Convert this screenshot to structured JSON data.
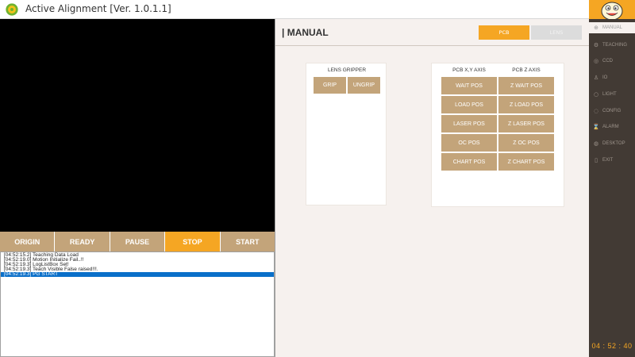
{
  "window": {
    "title": "Active Alignment [Ver. 1.0.1.1]"
  },
  "controls": [
    {
      "label": "ORIGIN",
      "active": false
    },
    {
      "label": "READY",
      "active": false
    },
    {
      "label": "PAUSE",
      "active": false
    },
    {
      "label": "STOP",
      "active": true
    },
    {
      "label": "START",
      "active": false
    }
  ],
  "log": [
    "[04:52:15.2]  Teaching Data Load",
    "[04:52:19.0]  Motion Initialize Fail..!!",
    "[04:52:19.3]  LogListBox Set!",
    "[04:52:19.3]  Teach Visible False raised!!!.",
    "[04:52:19.3]  PG START"
  ],
  "panel": {
    "title": "| MANUAL",
    "tabs": {
      "pcb": "PCB",
      "lens": "LENS"
    },
    "lens_gripper": {
      "header": "LENS GRIPPER",
      "grip": "GRIP",
      "ungrip": "UNGRIP"
    },
    "pcb_axis": {
      "xy_header": "PCB X,Y AXIS",
      "z_header": "PCB Z AXIS",
      "xy_buttons": [
        "WAIT POS",
        "LOAD POS",
        "LASER POS",
        "OC POS",
        "CHART POS"
      ],
      "z_buttons": [
        "Z WAIT POS",
        "Z LOAD POS",
        "Z LASER POS",
        "Z OC POS",
        "Z CHART POS"
      ]
    }
  },
  "sidebar": {
    "items": [
      {
        "label": "MANUAL",
        "icon": "manual-icon",
        "active": true
      },
      {
        "label": "TEACHING",
        "icon": "teaching-icon",
        "active": false
      },
      {
        "label": "CCD",
        "icon": "ccd-icon",
        "active": false
      },
      {
        "label": "IO",
        "icon": "io-icon",
        "active": false
      },
      {
        "label": "LIGHT",
        "icon": "light-icon",
        "active": false
      },
      {
        "label": "CONFIG",
        "icon": "config-icon",
        "active": false
      },
      {
        "label": "ALARM",
        "icon": "alarm-icon",
        "active": false
      },
      {
        "label": "DESKTOP",
        "icon": "desktop-icon",
        "active": false
      },
      {
        "label": "EXIT",
        "icon": "exit-icon",
        "active": false
      }
    ],
    "clock": "04 : 52 : 40"
  },
  "colors": {
    "accent": "#f5a623",
    "tan_button": "#c3a47a",
    "sidebar_bg": "#423a34",
    "log_selected": "#0a6fc9"
  }
}
